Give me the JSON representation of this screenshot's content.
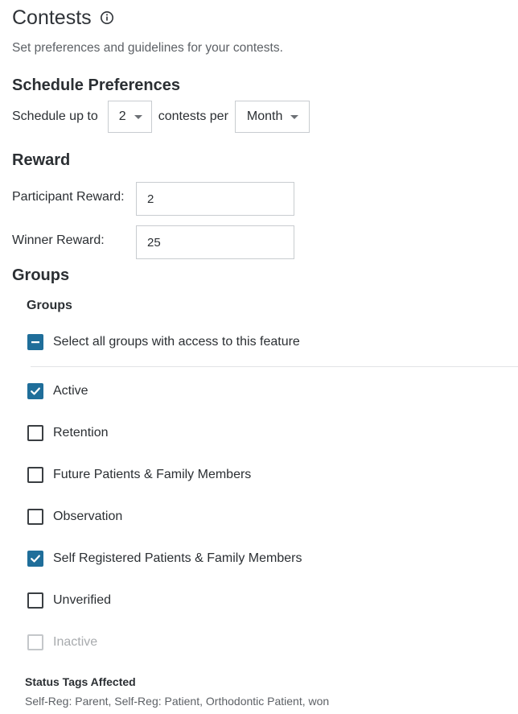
{
  "page": {
    "title": "Contests",
    "subtitle": "Set preferences and guidelines for your contests."
  },
  "schedule": {
    "heading": "Schedule Preferences",
    "prefix": "Schedule up to",
    "count_value": "2",
    "middle": "contests per",
    "period_value": "Month"
  },
  "reward": {
    "heading": "Reward",
    "participant_label": "Participant Reward:",
    "participant_value": "2",
    "winner_label": "Winner Reward:",
    "winner_value": "25"
  },
  "groups": {
    "heading": "Groups",
    "subheading": "Groups",
    "select_all_label": "Select all groups with access to this feature",
    "select_all_state": "indeterminate",
    "items": [
      {
        "label": "Active",
        "checked": true,
        "disabled": false
      },
      {
        "label": "Retention",
        "checked": false,
        "disabled": false
      },
      {
        "label": "Future Patients & Family Members",
        "checked": false,
        "disabled": false
      },
      {
        "label": "Observation",
        "checked": false,
        "disabled": false
      },
      {
        "label": "Self Registered Patients & Family Members",
        "checked": true,
        "disabled": false
      },
      {
        "label": "Unverified",
        "checked": false,
        "disabled": false
      },
      {
        "label": "Inactive",
        "checked": false,
        "disabled": true
      }
    ]
  },
  "status_tags": {
    "heading": "Status Tags Affected",
    "value": "Self-Reg: Parent, Self-Reg: Patient, Orthodontic Patient, won"
  },
  "colors": {
    "accent": "#1f6e9a",
    "text": "#2b2f33",
    "muted": "#5d6166",
    "border": "#c8ccd0"
  },
  "icons": {
    "title_info": "info-circle-icon",
    "dropdown": "caret-down-icon",
    "checked": "check-icon",
    "indeterminate": "minus-icon"
  }
}
